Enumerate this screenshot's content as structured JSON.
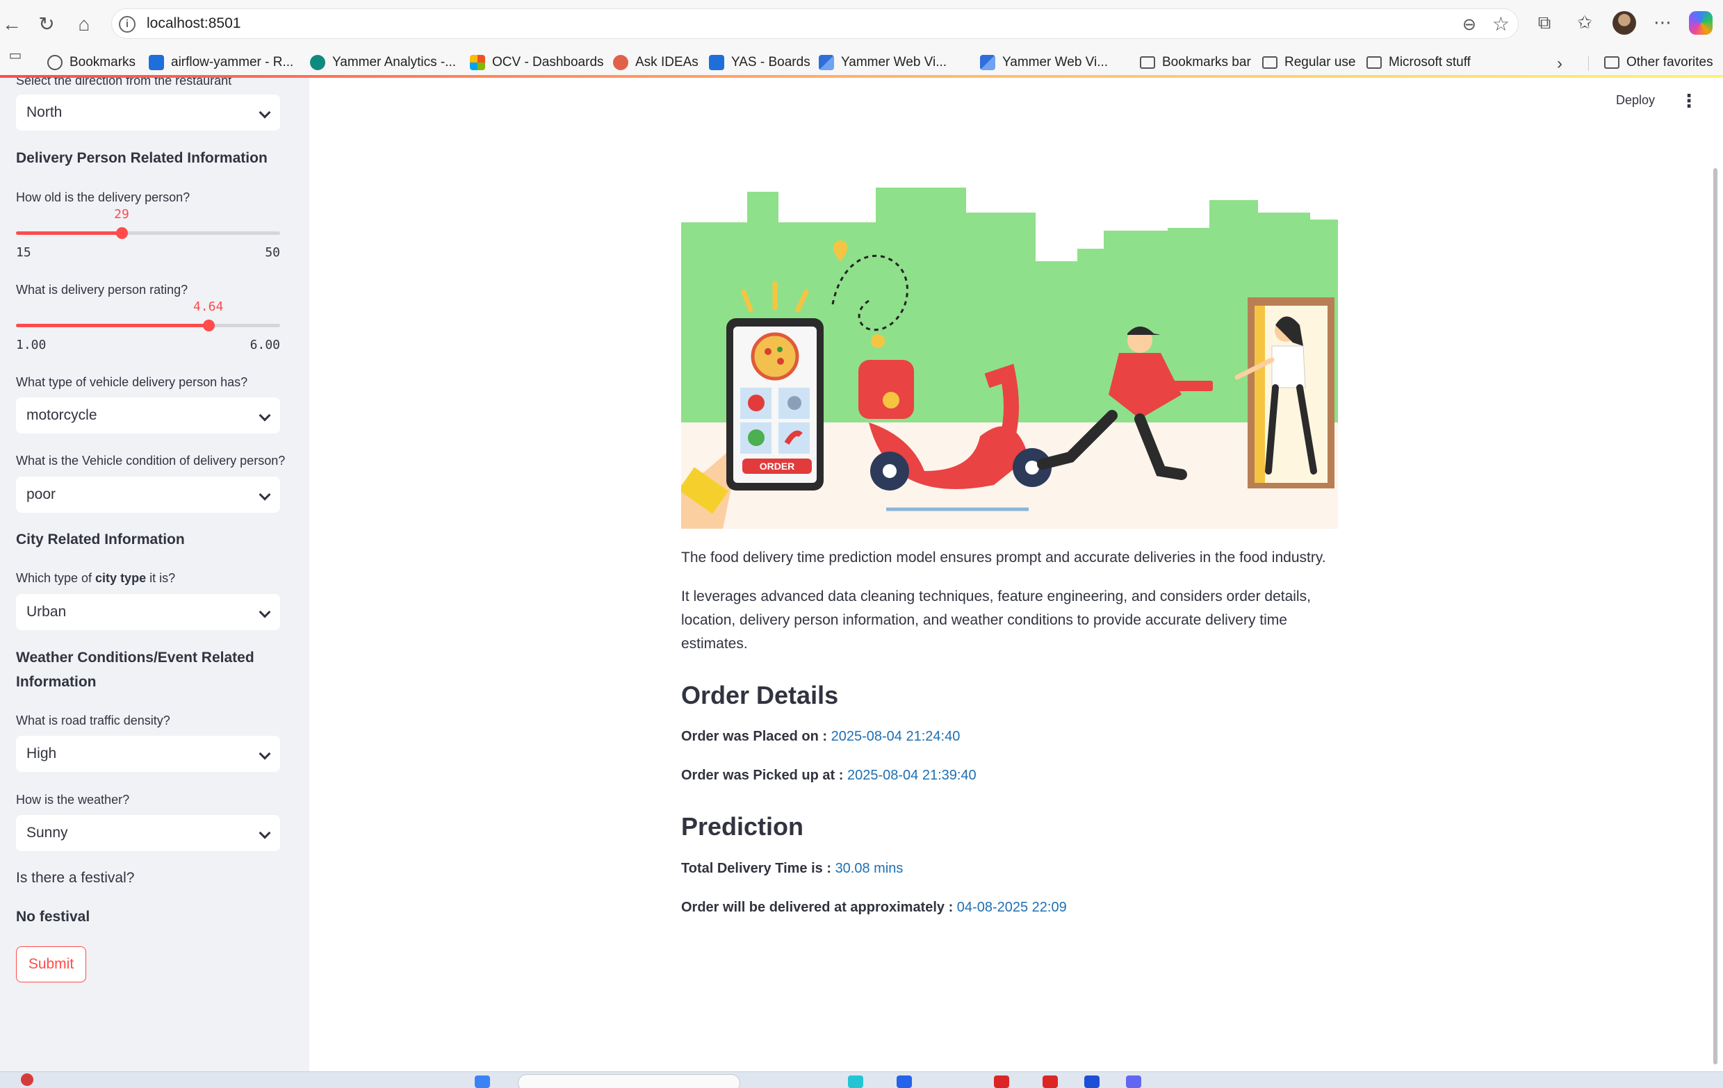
{
  "browser": {
    "url": "localhost:8501",
    "bookmarks": [
      {
        "label": "Bookmarks",
        "icon": "globe-icon"
      },
      {
        "label": "airflow-yammer - R...",
        "icon": "azure-devops-icon"
      },
      {
        "label": "Yammer Analytics -...",
        "icon": "yammer-icon"
      },
      {
        "label": "OCV - Dashboards",
        "icon": "microsoft-icon"
      },
      {
        "label": "Ask IDEAs",
        "icon": "ideas-icon"
      },
      {
        "label": "YAS - Boards",
        "icon": "azure-devops-icon"
      },
      {
        "label": "Yammer Web Vi...",
        "icon": "yammer-web-icon"
      },
      {
        "label": "Yammer Web Vi...",
        "icon": "yammer-web-icon"
      },
      {
        "label": "Bookmarks bar",
        "icon": "folder-icon"
      },
      {
        "label": "Regular use",
        "icon": "folder-icon"
      },
      {
        "label": "Microsoft stuff",
        "icon": "folder-icon"
      }
    ],
    "other_favorites": "Other favorites"
  },
  "sidebar": {
    "direction_label": "Select the direction from the restaurant",
    "direction_value": "North",
    "delivery_section": "Delivery Person Related Information",
    "age_label": "How old is the delivery person?",
    "age": {
      "value": "29",
      "min": "15",
      "max": "50",
      "fraction": 0.4
    },
    "rating_label": "What is delivery person rating?",
    "rating": {
      "value": "4.64",
      "min": "1.00",
      "max": "6.00",
      "fraction": 0.728
    },
    "vehicle_label": "What type of vehicle delivery person has?",
    "vehicle_value": "motorcycle",
    "condition_label": "What is the Vehicle condition of delivery person?",
    "condition_value": "poor",
    "city_section": "City Related Information",
    "city_label_pre": "Which type of ",
    "city_label_bold": "city type",
    "city_label_post": " it is?",
    "city_value": "Urban",
    "weather_section": "Weather Conditions/Event Related Information",
    "traffic_label": "What is road traffic density?",
    "traffic_value": "High",
    "weather_label": "How is the weather?",
    "weather_value": "Sunny",
    "festival_label": "Is there a festival?",
    "festival_value": "No festival",
    "submit_label": "Submit"
  },
  "header": {
    "deploy_label": "Deploy"
  },
  "main": {
    "intro_1": "The food delivery time prediction model ensures prompt and accurate deliveries in the food industry.",
    "intro_2": "It leverages advanced data cleaning techniques, feature engineering, and considers order details, location, delivery person information, and weather conditions to provide accurate delivery time estimates.",
    "order_heading": "Order Details",
    "placed_label": "Order was Placed on : ",
    "placed_value": "2025-08-04 21:24:40",
    "picked_label": "Order was Picked up at : ",
    "picked_value": "2025-08-04 21:39:40",
    "prediction_heading": "Prediction",
    "total_label": "Total Delivery Time is : ",
    "total_value": "30.08 mins",
    "eta_label": "Order will be delivered at approximately : ",
    "eta_value": "04-08-2025 22:09",
    "illustration_order_text": "ORDER"
  },
  "colors": {
    "accent": "#ff4b4b",
    "link_value": "#1f6fb4",
    "sidebar_bg": "#f0f2f6",
    "illus_green": "#8fe08a"
  }
}
